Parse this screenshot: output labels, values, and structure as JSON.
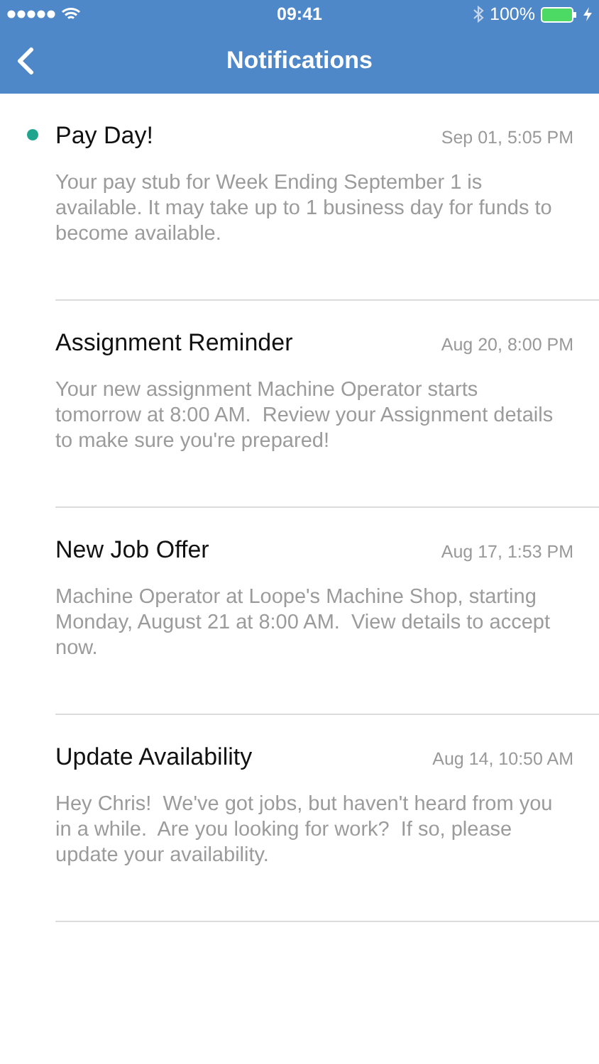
{
  "status_bar": {
    "time": "09:41",
    "battery": "100%"
  },
  "nav": {
    "title": "Notifications"
  },
  "notifications": [
    {
      "title": "Pay Day!",
      "date": "Sep 01, 5:05 PM",
      "unread": true,
      "body": "Your pay stub for Week Ending September 1 is available. It may take up to 1 business day for funds to become available."
    },
    {
      "title": "Assignment Reminder",
      "date": "Aug 20, 8:00 PM",
      "unread": false,
      "body": "Your new assignment Machine Operator starts tomorrow at 8:00 AM.  Review your Assignment details to make sure you're prepared!"
    },
    {
      "title": "New Job Offer",
      "date": "Aug 17, 1:53 PM",
      "unread": false,
      "body": "Machine Operator at Loope's Machine Shop, starting Monday, August 21 at 8:00 AM.  View details to accept now."
    },
    {
      "title": "Update Availability",
      "date": "Aug 14, 10:50 AM",
      "unread": false,
      "body": "Hey Chris!  We've got jobs, but haven't heard from you in a while.  Are you looking for work?  If so, please update your availability."
    }
  ]
}
